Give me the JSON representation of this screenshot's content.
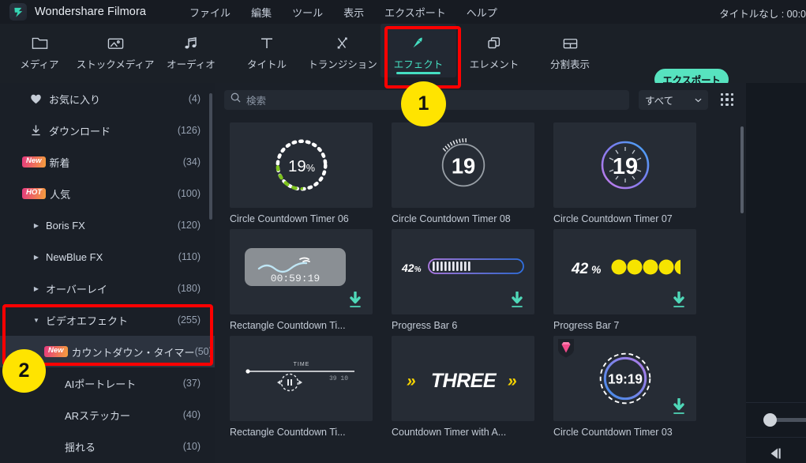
{
  "titlebar": {
    "brand": "Wondershare Filmora",
    "logo_icon": "filmora-logo-icon",
    "menus": [
      "ファイル",
      "編集",
      "ツール",
      "表示",
      "エクスポート",
      "ヘルプ"
    ],
    "document_title": "タイトルなし : 00:0"
  },
  "toolbar": {
    "tabs": [
      {
        "label": "メディア",
        "icon": "folder-icon",
        "active": false
      },
      {
        "label": "ストックメディア",
        "icon": "stock-media-icon",
        "active": false
      },
      {
        "label": "オーディオ",
        "icon": "audio-note-icon",
        "active": false
      },
      {
        "label": "タイトル",
        "icon": "title-text-icon",
        "active": false
      },
      {
        "label": "トランジション",
        "icon": "transition-arrows-icon",
        "active": false
      },
      {
        "label": "エフェクト",
        "icon": "effects-magic-wand-icon",
        "active": true
      },
      {
        "label": "エレメント",
        "icon": "elements-layers-icon",
        "active": false
      },
      {
        "label": "分割表示",
        "icon": "split-screen-icon",
        "active": false
      }
    ],
    "export_label": "エクスポート"
  },
  "sidebar": {
    "items": [
      {
        "label": "お気に入り",
        "count": "(4)",
        "icon": "heart-icon",
        "tag": null,
        "arrow": null,
        "indent": 0,
        "selected": false
      },
      {
        "label": "ダウンロード",
        "count": "(126)",
        "icon": "download-icon",
        "tag": null,
        "arrow": null,
        "indent": 0,
        "selected": false
      },
      {
        "label": "新着",
        "count": "(34)",
        "icon": null,
        "tag": "New",
        "arrow": null,
        "indent": 0,
        "selected": false
      },
      {
        "label": "人気",
        "count": "(100)",
        "icon": null,
        "tag": "HOT",
        "arrow": null,
        "indent": 0,
        "selected": false
      },
      {
        "label": "Boris FX",
        "count": "(120)",
        "icon": null,
        "tag": null,
        "arrow": "collapsed",
        "indent": 0,
        "selected": false
      },
      {
        "label": "NewBlue FX",
        "count": "(110)",
        "icon": null,
        "tag": null,
        "arrow": "collapsed",
        "indent": 0,
        "selected": false
      },
      {
        "label": "オーバーレイ",
        "count": "(180)",
        "icon": null,
        "tag": null,
        "arrow": "collapsed",
        "indent": 0,
        "selected": false
      },
      {
        "label": "ビデオエフェクト",
        "count": "(255)",
        "icon": null,
        "tag": null,
        "arrow": "expanded",
        "indent": 0,
        "selected": false
      },
      {
        "label": "カウントダウン・タイマー",
        "count": "(50)",
        "icon": null,
        "tag": "New",
        "arrow": null,
        "indent": 1,
        "selected": true
      },
      {
        "label": "AIポートレート",
        "count": "(37)",
        "icon": null,
        "tag": null,
        "arrow": null,
        "indent": 2,
        "selected": false
      },
      {
        "label": "ARステッカー",
        "count": "(40)",
        "icon": null,
        "tag": null,
        "arrow": null,
        "indent": 2,
        "selected": false
      },
      {
        "label": "揺れる",
        "count": "(10)",
        "icon": null,
        "tag": null,
        "arrow": null,
        "indent": 2,
        "selected": false
      }
    ],
    "collapse_icon": "collapse-left-arrow-icon"
  },
  "search": {
    "placeholder": "検索",
    "icon": "search-icon",
    "filter_value": "すべて",
    "filter_chevron_icon": "chevron-down-icon",
    "grid_view_icon": "grid-view-icon"
  },
  "effects": {
    "rows": [
      [
        {
          "name": "Circle Countdown Timer 06",
          "thumb": "circle-dotted-percent",
          "value": "19%",
          "downloadable": false,
          "premium": false
        },
        {
          "name": "Circle Countdown Timer 08",
          "thumb": "circle-ticks-number",
          "value": "19",
          "downloadable": false,
          "premium": false
        },
        {
          "name": "Circle Countdown Timer 07",
          "thumb": "circle-gradient-ray",
          "value": "19",
          "downloadable": false,
          "premium": false
        }
      ],
      [
        {
          "name": "Rectangle Countdown Ti...",
          "thumb": "rect-wave-clock",
          "value": "00:59:19",
          "downloadable": true,
          "premium": false
        },
        {
          "name": "Progress Bar 6",
          "thumb": "progress-bar-segments",
          "value": "42%",
          "downloadable": true,
          "premium": false
        },
        {
          "name": "Progress Bar 7",
          "thumb": "progress-dots-yellow",
          "value": "42%",
          "downloadable": true,
          "premium": false
        }
      ],
      [
        {
          "name": "Rectangle Countdown Ti...",
          "thumb": "timeline-pause-scrub",
          "value": "TIME",
          "downloadable": false,
          "premium": false
        },
        {
          "name": "Countdown Timer with A...",
          "thumb": "three-word-chevrons",
          "value": "THREE",
          "downloadable": false,
          "premium": false
        },
        {
          "name": "Circle Countdown Timer 03",
          "thumb": "circle-dashed-clock",
          "value": "19:19",
          "downloadable": true,
          "premium": true
        }
      ]
    ],
    "download_icon": "download-arrow-icon",
    "premium_icon": "premium-gem-icon"
  },
  "rightpanel": {
    "slider_handle_icon": "volume-slider-knob",
    "prev_frame_icon": "previous-frame-icon"
  },
  "annotations": [
    {
      "label": "1",
      "target": "effects-tab"
    },
    {
      "label": "2",
      "target": "countdown-timer-category"
    }
  ],
  "colors": {
    "accent": "#45dfc2",
    "export_button": "#57e3bf",
    "annotation_red": "#ff0000",
    "annotation_yellow": "#ffe400",
    "panel_bg": "#1b2028",
    "sidebar_bg": "#1a1f27"
  }
}
